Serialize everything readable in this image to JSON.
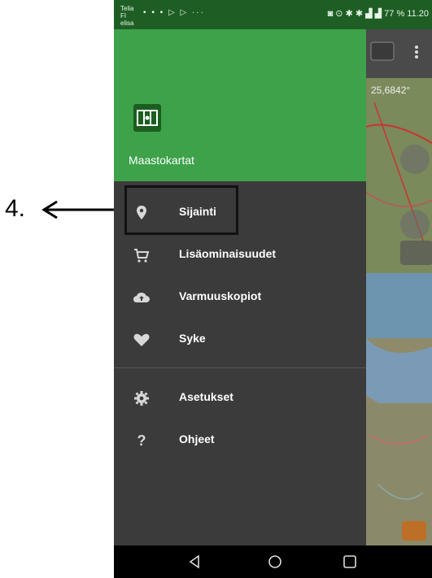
{
  "annotation": {
    "step_label": "4."
  },
  "status_bar": {
    "carrier": "Telia FI elisa",
    "battery_and_time": "77 % 11.20"
  },
  "map": {
    "coordinate": "25,6842°"
  },
  "drawer": {
    "app_title": "Maastokartat",
    "items": [
      {
        "label": "Sijainti",
        "icon": "location-pin-icon"
      },
      {
        "label": "Lisäominaisuudet",
        "icon": "cart-icon"
      },
      {
        "label": "Varmuuskopiot",
        "icon": "cloud-upload-icon"
      },
      {
        "label": "Syke",
        "icon": "heart-icon"
      },
      {
        "label": "Asetukset",
        "icon": "gear-icon"
      },
      {
        "label": "Ohjeet",
        "icon": "question-icon"
      }
    ]
  },
  "colors": {
    "drawer_header": "#3da24a",
    "status_bar": "#1e5e24",
    "drawer_body": "#3b3b3b"
  }
}
